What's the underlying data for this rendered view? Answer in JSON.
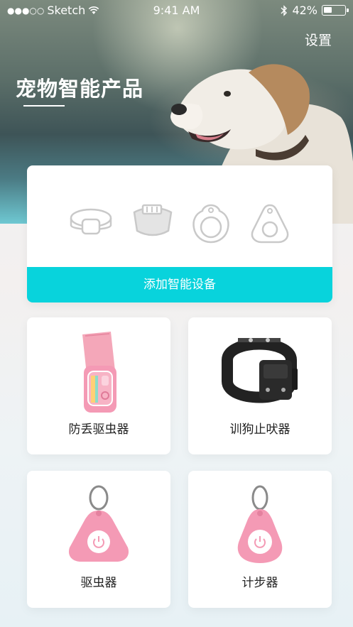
{
  "status_bar": {
    "carrier_dots": "●●●○○",
    "carrier": "Sketch",
    "time": "9:41 AM",
    "battery": "42%",
    "battery_level": 0.42,
    "icons": [
      "wifi-icon",
      "bluetooth-icon",
      "battery-icon"
    ]
  },
  "header": {
    "settings_label": "设置",
    "title": "宠物智能产品"
  },
  "add_device": {
    "device_icons": [
      "collar-icon",
      "wide-collar-icon",
      "round-tag-icon",
      "drop-tag-icon"
    ],
    "button_label": "添加智能设备"
  },
  "products": [
    {
      "label": "防丢驱虫器",
      "icon": "pink-collar-device"
    },
    {
      "label": "训狗止吠器",
      "icon": "black-bark-collar"
    },
    {
      "label": "驱虫器",
      "icon": "pink-triangle-tag"
    },
    {
      "label": "计步器",
      "icon": "pink-drop-tag"
    }
  ],
  "colors": {
    "accent": "#08d3dc",
    "product_pink": "#f49ab5",
    "card_bg": "#ffffff"
  }
}
